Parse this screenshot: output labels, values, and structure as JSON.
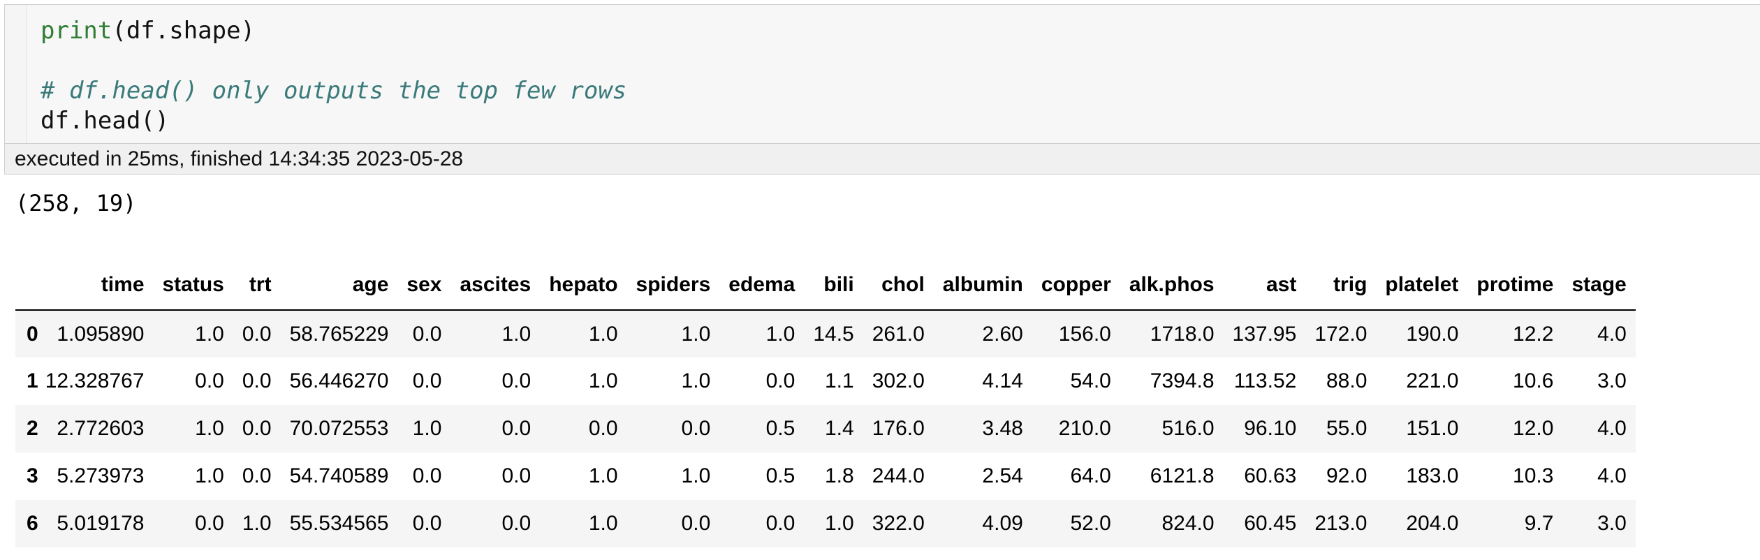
{
  "code": {
    "line1_fn": "print",
    "line1_rest": "(df.shape)",
    "line2": "",
    "line3_comment": "# df.head() only outputs the top few rows",
    "line4": "df.head()"
  },
  "execution": {
    "status_text": "executed in 25ms, finished 14:34:35 2023-05-28"
  },
  "output": {
    "stdout": "(258, 19)"
  },
  "dataframe": {
    "columns": [
      "time",
      "status",
      "trt",
      "age",
      "sex",
      "ascites",
      "hepato",
      "spiders",
      "edema",
      "bili",
      "chol",
      "albumin",
      "copper",
      "alk.phos",
      "ast",
      "trig",
      "platelet",
      "protime",
      "stage"
    ],
    "rows": [
      {
        "index": "0",
        "cells": [
          "1.095890",
          "1.0",
          "0.0",
          "58.765229",
          "0.0",
          "1.0",
          "1.0",
          "1.0",
          "1.0",
          "14.5",
          "261.0",
          "2.60",
          "156.0",
          "1718.0",
          "137.95",
          "172.0",
          "190.0",
          "12.2",
          "4.0"
        ]
      },
      {
        "index": "1",
        "cells": [
          "12.328767",
          "0.0",
          "0.0",
          "56.446270",
          "0.0",
          "0.0",
          "1.0",
          "1.0",
          "0.0",
          "1.1",
          "302.0",
          "4.14",
          "54.0",
          "7394.8",
          "113.52",
          "88.0",
          "221.0",
          "10.6",
          "3.0"
        ]
      },
      {
        "index": "2",
        "cells": [
          "2.772603",
          "1.0",
          "0.0",
          "70.072553",
          "1.0",
          "0.0",
          "0.0",
          "0.0",
          "0.5",
          "1.4",
          "176.0",
          "3.48",
          "210.0",
          "516.0",
          "96.10",
          "55.0",
          "151.0",
          "12.0",
          "4.0"
        ]
      },
      {
        "index": "3",
        "cells": [
          "5.273973",
          "1.0",
          "0.0",
          "54.740589",
          "0.0",
          "0.0",
          "1.0",
          "1.0",
          "0.5",
          "1.8",
          "244.0",
          "2.54",
          "64.0",
          "6121.8",
          "60.63",
          "92.0",
          "183.0",
          "10.3",
          "4.0"
        ]
      },
      {
        "index": "6",
        "cells": [
          "5.019178",
          "0.0",
          "1.0",
          "55.534565",
          "0.0",
          "0.0",
          "1.0",
          "0.0",
          "0.0",
          "1.0",
          "322.0",
          "4.09",
          "52.0",
          "824.0",
          "60.45",
          "213.0",
          "204.0",
          "9.7",
          "3.0"
        ]
      }
    ]
  },
  "colors": {
    "builtin_function": "#2f7d32",
    "comment": "#3b7a7a",
    "input_background": "#f7f7f7",
    "striped_row": "#f5f5f5"
  }
}
